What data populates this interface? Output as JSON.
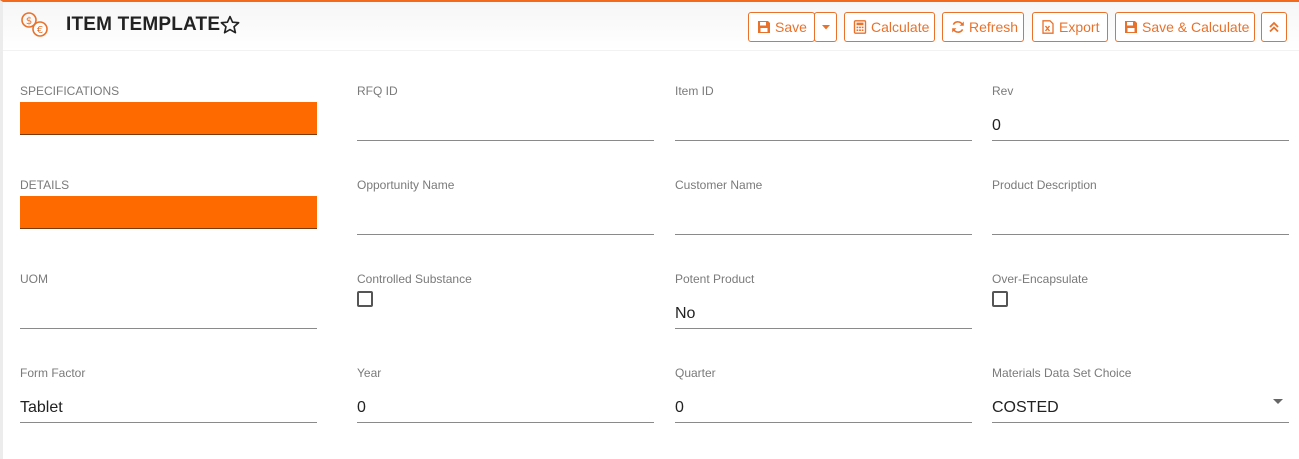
{
  "header": {
    "title": "ITEM TEMPLATE",
    "icons": {
      "app": "currency-exchange-icon",
      "favorite": "star-outline-icon"
    }
  },
  "toolbar": {
    "save_label": "Save",
    "calculate_label": "Calculate",
    "refresh_label": "Refresh",
    "export_label": "Export",
    "save_calculate_label": "Save & Calculate",
    "accent_color": "#e8722c"
  },
  "form": {
    "specifications": {
      "label": "SPECIFICATIONS",
      "color": "#ff6a00"
    },
    "rfq_id": {
      "label": "RFQ ID",
      "value": ""
    },
    "item_id": {
      "label": "Item ID",
      "value": ""
    },
    "rev": {
      "label": "Rev",
      "value": "0"
    },
    "details": {
      "label": "DETAILS",
      "color": "#ff6a00"
    },
    "opportunity_name": {
      "label": "Opportunity Name",
      "value": ""
    },
    "customer_name": {
      "label": "Customer Name",
      "value": ""
    },
    "product_description": {
      "label": "Product Description",
      "value": ""
    },
    "uom": {
      "label": "UOM",
      "value": ""
    },
    "controlled_substance": {
      "label": "Controlled Substance",
      "checked": false
    },
    "potent_product": {
      "label": "Potent Product",
      "value": "No"
    },
    "over_encapsulate": {
      "label": "Over-Encapsulate",
      "checked": false
    },
    "form_factor": {
      "label": "Form Factor",
      "value": "Tablet"
    },
    "year": {
      "label": "Year",
      "value": "0"
    },
    "quarter": {
      "label": "Quarter",
      "value": "0"
    },
    "materials_data_set_choice": {
      "label": "Materials Data Set Choice",
      "value": "COSTED"
    }
  }
}
